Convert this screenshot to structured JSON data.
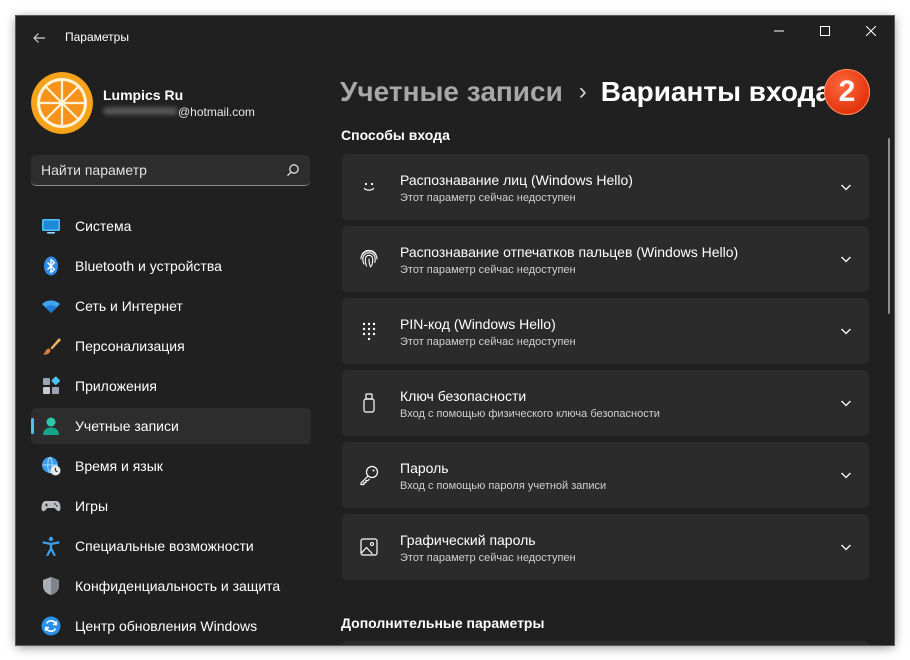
{
  "window": {
    "title": "Параметры",
    "controls": {
      "minimize": "minimize-icon",
      "maximize": "maximize-icon",
      "close": "close-icon"
    }
  },
  "profile": {
    "name": "Lumpics Ru",
    "email": "@hotmail.com"
  },
  "search": {
    "placeholder": "Найти параметр"
  },
  "sidebar": {
    "items": [
      {
        "label": "Система",
        "icon": "monitor-icon"
      },
      {
        "label": "Bluetooth и устройства",
        "icon": "bluetooth-icon"
      },
      {
        "label": "Сеть и Интернет",
        "icon": "wifi-icon"
      },
      {
        "label": "Персонализация",
        "icon": "brush-icon"
      },
      {
        "label": "Приложения",
        "icon": "apps-icon"
      },
      {
        "label": "Учетные записи",
        "icon": "person-icon",
        "active": true
      },
      {
        "label": "Время и язык",
        "icon": "globe-clock-icon"
      },
      {
        "label": "Игры",
        "icon": "gamepad-icon"
      },
      {
        "label": "Специальные возможности",
        "icon": "accessibility-icon"
      },
      {
        "label": "Конфиденциальность и защита",
        "icon": "shield-icon"
      },
      {
        "label": "Центр обновления Windows",
        "icon": "update-icon"
      }
    ]
  },
  "breadcrumb": {
    "parent": "Учетные записи",
    "separator": "›",
    "current": "Варианты входа"
  },
  "annotation": {
    "badge": "2"
  },
  "main": {
    "section_title": "Способы входа",
    "options": [
      {
        "title": "Распознавание лиц (Windows Hello)",
        "subtitle": "Этот параметр сейчас недоступен",
        "icon": "face-icon"
      },
      {
        "title": "Распознавание отпечатков пальцев (Windows Hello)",
        "subtitle": "Этот параметр сейчас недоступен",
        "icon": "fingerprint-icon"
      },
      {
        "title": "PIN-код (Windows Hello)",
        "subtitle": "Этот параметр сейчас недоступен",
        "icon": "pin-keypad-icon"
      },
      {
        "title": "Ключ безопасности",
        "subtitle": "Вход с помощью физического ключа безопасности",
        "icon": "usb-key-icon"
      },
      {
        "title": "Пароль",
        "subtitle": "Вход с помощью пароля учетной записи",
        "icon": "key-icon"
      },
      {
        "title": "Графический пароль",
        "subtitle": "Этот параметр сейчас недоступен",
        "icon": "picture-icon"
      }
    ],
    "additional_title": "Дополнительные параметры"
  },
  "colors": {
    "accent": "#4cc2ff",
    "badge": "#e2330c",
    "background": "#202020",
    "card": "#2b2b2b"
  }
}
